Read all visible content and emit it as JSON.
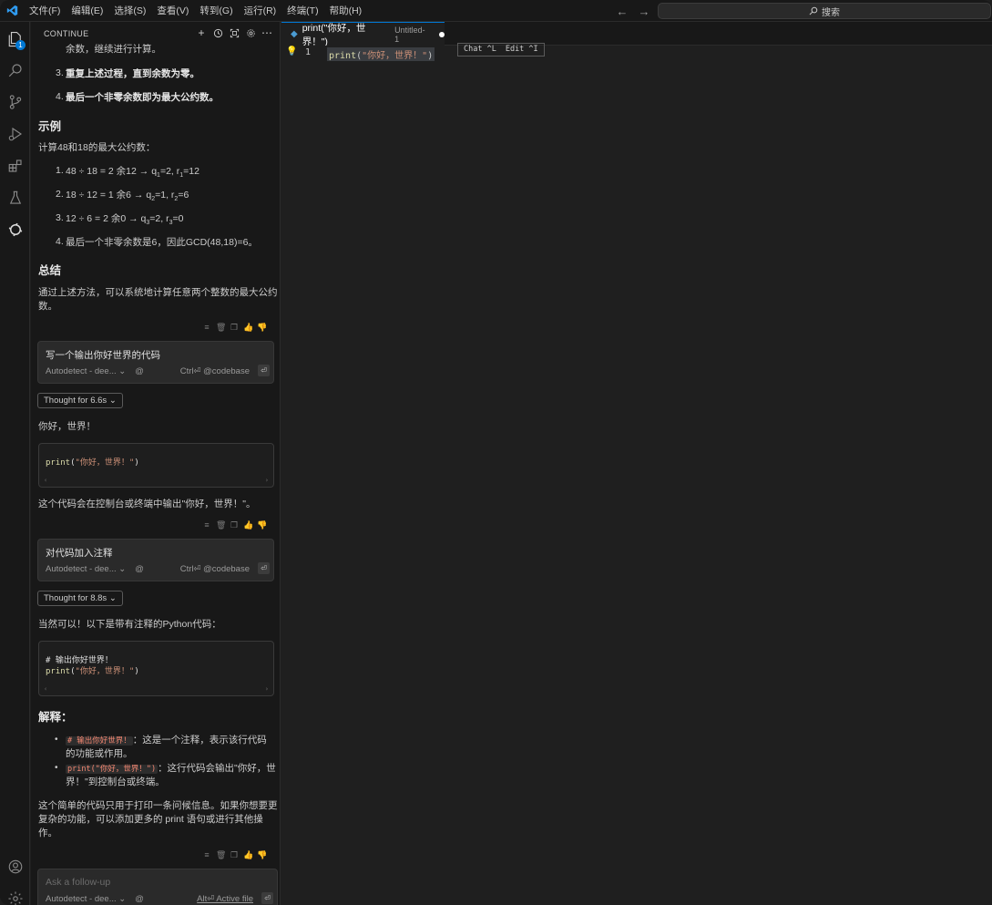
{
  "menu": [
    "文件(F)",
    "编辑(E)",
    "选择(S)",
    "查看(V)",
    "转到(G)",
    "运行(R)",
    "终端(T)",
    "帮助(H)"
  ],
  "search": {
    "label": "搜索"
  },
  "activity": {
    "explorer_badge": "1"
  },
  "panel": {
    "title": "CONTINUE"
  },
  "chat": {
    "step2_tail": "余数，继续进行计算。",
    "step3_num": "3.",
    "step3": "重复上述过程，直到余数为零。",
    "step4_num": "4.",
    "step4": "最后一个非零余数即为最大公约数。",
    "example_heading": "示例",
    "example_intro": "计算48和18的最大公约数：",
    "ex1_num": "1.",
    "ex1": "48 ÷ 18 = 2 余12 → q",
    "ex2_num": "2.",
    "ex2": "18 ÷ 12 = 1 余6 → q",
    "ex3_num": "3.",
    "ex3": "12 ÷ 6 = 2 余0 → q",
    "ex4_num": "4.",
    "ex4": "最后一个非零余数是6，因此GCD(48,18)=6。",
    "ex1_q": "1",
    "ex1_qv": "=2, r",
    "ex1_r": "1",
    "ex1_rv": "=12",
    "ex2_q": "2",
    "ex2_qv": "=1, r",
    "ex2_r": "2",
    "ex2_rv": "=6",
    "ex3_q": "3",
    "ex3_qv": "=2, r",
    "ex3_r": "3",
    "ex3_rv": "=0",
    "summary_heading": "总结",
    "summary_line1": "通过上述方法，可以系统地计算任意两个整数的最大公约",
    "summary_line2": "数。",
    "user1": "写一个输出你好世界的代码",
    "model_label": "Autodetect - dee...",
    "at": "@",
    "codebase_hint": "Ctrl⏎ @codebase",
    "thought1": "Thought for 6.6s",
    "reply1": "你好，世界！",
    "code1": "print(\"你好，世界！\")",
    "reply1_after": "这个代码会在控制台或终端中输出\"你好，世界！\"。",
    "user2": "对代码加入注释",
    "thought2": "Thought for 8.8s",
    "reply2": "当然可以！以下是带有注释的Python代码：",
    "code2_line1": "# 输出你好世界！",
    "code2_line2": "print(\"你好，世界！\")",
    "explain_heading": "解释：",
    "bullet1_code": "# 输出你好世界！",
    "bullet1_a": "：这是一个注释，表示该行代码",
    "bullet1_b": "的功能或作用。",
    "bullet2_code": "print(\"你好，世界！\")",
    "bullet2_a": "：这行代码会输出\"你好，世",
    "bullet2_b": "界！\"到控制台或终端。",
    "closing1": "这个简单的代码只用于打印一条问候信息。如果你想要更",
    "closing2": "复杂的功能，可以添加更多的 print 语句或进行其他操",
    "closing3": "作。",
    "followup_placeholder": "Ask a follow-up",
    "active_file": "Alt⏎ Active file",
    "enter_symbol": "⏎"
  },
  "editor": {
    "tab_name": "print(\"你好，世界！\")",
    "tab_desc": "Untitled-1",
    "line_number": "1",
    "code": "print(\"你好，世界！\")",
    "hint_chat": "Chat ^L",
    "hint_edit": "Edit ^I"
  },
  "colors": {
    "accent": "#0078d4",
    "string": "#ce9178",
    "function": "#dcdcaa",
    "comment": "#6a9955"
  }
}
